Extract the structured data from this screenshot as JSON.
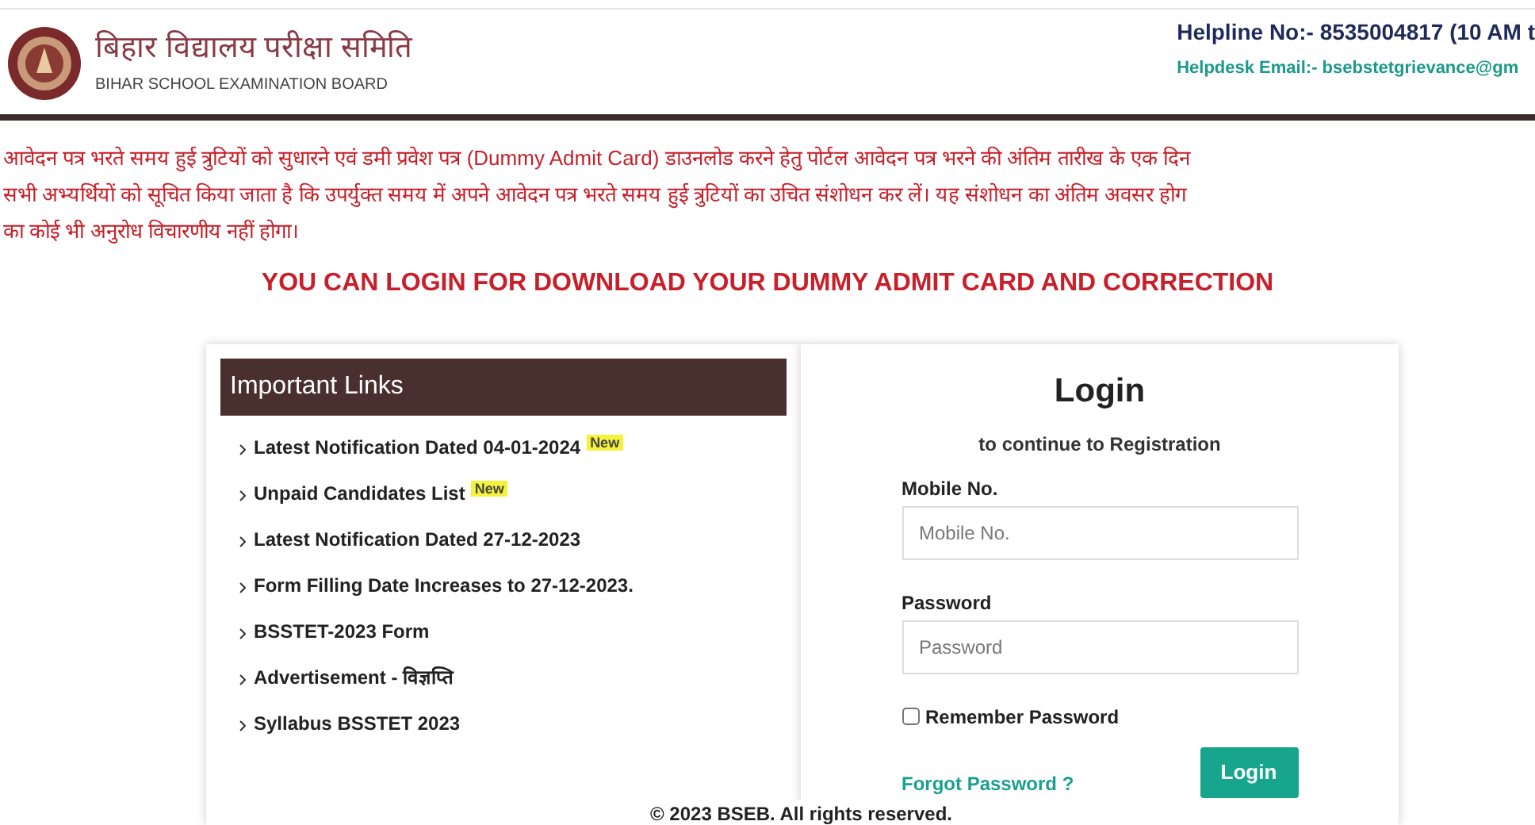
{
  "header": {
    "title_hindi": "बिहार विद्यालय परीक्षा समिति",
    "title_english": "BIHAR SCHOOL EXAMINATION BOARD",
    "helpline": "Helpline No:- 8535004817 (10 AM t",
    "helpdesk": "Helpdesk Email:- bsebstetgrievance@gm"
  },
  "notice": [
    "आवेदन पत्र भरते समय हुई त्रुटियों को सुधारने एवं डमी प्रवेश पत्र (Dummy Admit Card) डाउनलोड करने हेतु पोर्टल आवेदन पत्र भरने की अंतिम तारीख के एक दिन",
    "सभी अभ्यर्थियों को सूचित किया जाता है कि उपर्युक्त समय में अपने आवेदन पत्र भरते समय हुई त्रुटियों का उचित संशोधन कर लें। यह संशोधन का अंतिम अवसर होग",
    "का कोई भी अनुरोध विचारणीय नहीं होगा।"
  ],
  "banner": "YOU CAN LOGIN FOR DOWNLOAD YOUR DUMMY ADMIT CARD AND CORRECTION",
  "links_panel": {
    "title": "Important Links",
    "items": [
      {
        "label": "Latest Notification Dated 04-01-2024",
        "badge": "New"
      },
      {
        "label": "Unpaid Candidates List",
        "badge": "New"
      },
      {
        "label": "Latest Notification Dated 27-12-2023"
      },
      {
        "label": "Form Filling Date Increases to 27-12-2023."
      },
      {
        "label": "BSSTET-2023 Form"
      },
      {
        "label": "Advertisement - विज्ञप्ति"
      },
      {
        "label": "Syllabus BSSTET 2023"
      }
    ]
  },
  "login": {
    "title": "Login",
    "subtitle": "to continue to Registration",
    "fields": [
      {
        "label": "Mobile No.",
        "placeholder": "Mobile No."
      },
      {
        "label": "Password",
        "placeholder": "Password"
      }
    ],
    "remember": {
      "label": "Remember Password",
      "checked": false
    },
    "forgot": "Forgot Password ?",
    "button": "Login"
  },
  "footer": "© 2023 BSEB. All rights reserved."
}
